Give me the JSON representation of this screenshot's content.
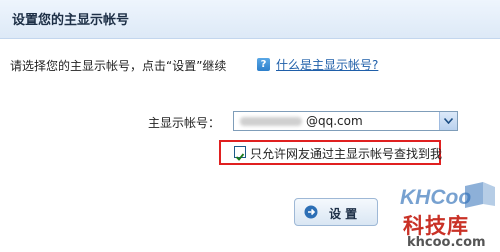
{
  "header": {
    "title": "设置您的主显示帐号"
  },
  "intro": {
    "text": "请选择您的主显示帐号，点击“设置”继续",
    "help_link": "什么是主显示帐号?"
  },
  "account": {
    "label": "主显示帐号：",
    "selected_value": "@qq.com"
  },
  "allow_search": {
    "checked": true,
    "label": "只允许网友通过主显示帐号查找到我"
  },
  "actions": {
    "set_label": "设 置"
  },
  "watermark": {
    "brand": "KHCoo",
    "cn_name": "科技库",
    "url": "khcoo.com"
  },
  "colors": {
    "link": "#1f5fa9",
    "highlight_border": "#e02020",
    "watermark_red": "#c93126",
    "watermark_blue": "#2f6fb8"
  },
  "icons": {
    "help": "help-icon",
    "dropdown": "chevron-down-icon",
    "checkbox": "checkmark-icon",
    "button": "arrow-right-circle-icon"
  }
}
